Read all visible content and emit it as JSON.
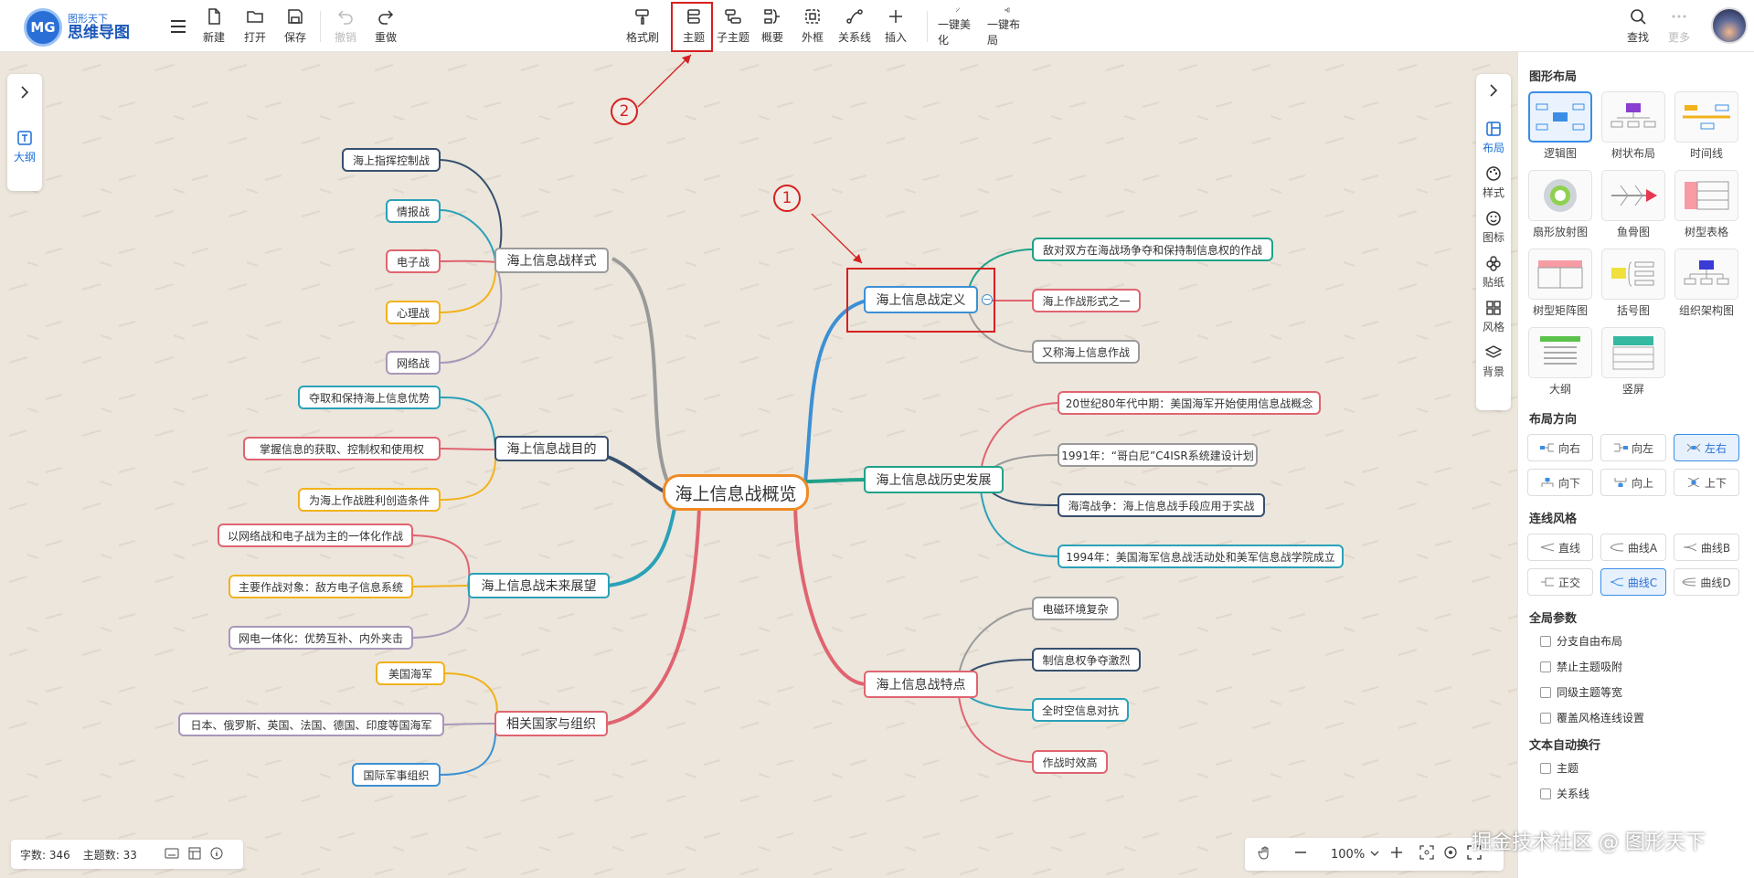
{
  "app": {
    "logo_mark": "MG",
    "logo_sub": "图形天下",
    "logo_main": "思维导图"
  },
  "toolbar": {
    "new": "新建",
    "open": "打开",
    "save": "保存",
    "undo": "撤销",
    "redo": "重做",
    "format_brush": "格式刷",
    "topic": "主题",
    "subtopic": "子主题",
    "summary": "概要",
    "frame": "外框",
    "relation": "关系线",
    "insert": "插入",
    "beautify": "一键美化",
    "auto_layout": "一键布局",
    "search": "查找",
    "more": "更多"
  },
  "left_panel": {
    "outline": "大纲"
  },
  "right_tabs": {
    "layout": "布局",
    "style": "样式",
    "icon": "图标",
    "sticker": "贴纸",
    "theme": "风格",
    "background": "背景"
  },
  "right_panel": {
    "layout_title": "图形布局",
    "layouts": [
      "逻辑图",
      "树状布局",
      "时间线",
      "扇形放射图",
      "鱼骨图",
      "树型表格",
      "树型矩阵图",
      "括号图",
      "组织架构图",
      "大纲",
      "竖屏"
    ],
    "direction_title": "布局方向",
    "directions": [
      "向右",
      "向左",
      "左右",
      "向下",
      "向上",
      "上下"
    ],
    "line_style_title": "连线风格",
    "line_styles": [
      "直线",
      "曲线A",
      "曲线B",
      "正交",
      "曲线C",
      "曲线D"
    ],
    "global_title": "全局参数",
    "global_options": [
      "分支自由布局",
      "禁止主题吸附",
      "同级主题等宽",
      "覆盖风格连线设置"
    ],
    "wrap_title": "文本自动换行",
    "wrap_options": [
      "主题",
      "关系线"
    ]
  },
  "mindmap": {
    "root": "海上信息战概览",
    "topics": {
      "style": "海上信息战样式",
      "purpose": "海上信息战目的",
      "future": "海上信息战未来展望",
      "nations": "相关国家与组织",
      "definition": "海上信息战定义",
      "history": "海上信息战历史发展",
      "features": "海上信息战特点"
    },
    "style_items": [
      "海上指挥控制战",
      "情报战",
      "电子战",
      "心理战",
      "网络战"
    ],
    "purpose_items": [
      "夺取和保持海上信息优势",
      "掌握信息的获取、控制权和使用权",
      "为海上作战胜利创造条件"
    ],
    "future_items": [
      "以网络战和电子战为主的一体化作战",
      "主要作战对象：敌方电子信息系统",
      "网电一体化：优势互补、内外夹击"
    ],
    "nations_items": [
      "美国海军",
      "日本、俄罗斯、英国、法国、德国、印度等国海军",
      "国际军事组织"
    ],
    "definition_items": [
      "敌对双方在海战场争夺和保持制信息权的作战",
      "海上作战形式之一",
      "又称海上信息作战"
    ],
    "history_items": [
      "20世纪80年代中期：美国海军开始使用信息战概念",
      "1991年：“哥白尼”C4ISR系统建设计划",
      "海湾战争：海上信息战手段应用于实战",
      "1994年：美国海军信息战活动处和美军信息战学院成立"
    ],
    "features_items": [
      "电磁环境复杂",
      "制信息权争夺激烈",
      "全时空信息对抗",
      "作战时效高"
    ],
    "collapse_symbol": "−"
  },
  "annotations": {
    "marker1": "1",
    "marker2": "2"
  },
  "status": {
    "char_count": "字数: 346",
    "topic_count": "主题数: 33"
  },
  "zoom": {
    "level": "100%"
  },
  "watermark": "掘金技术社区 @ 图形天下",
  "colors": {
    "accent": "#2a6fd6",
    "highlight": "#d62020",
    "root_border": "#f08a24",
    "canvas_bg": "#ece6dc"
  }
}
